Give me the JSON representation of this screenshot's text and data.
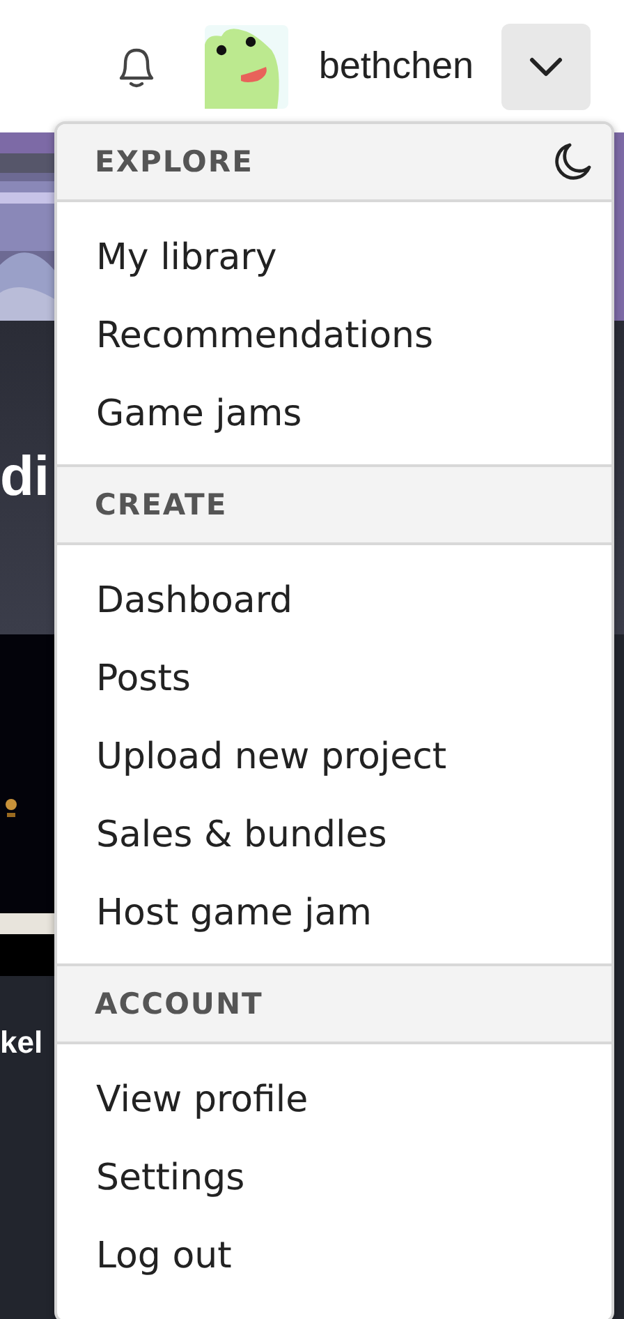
{
  "header": {
    "username": "bethchen"
  },
  "background": {
    "heading": "di",
    "subheading": "kel"
  },
  "menu": {
    "sections": [
      {
        "title": "EXPLORE",
        "night_toggle": true,
        "items": [
          "My library",
          "Recommendations",
          "Game jams"
        ]
      },
      {
        "title": "CREATE",
        "items": [
          "Dashboard",
          "Posts",
          "Upload new project",
          "Sales & bundles",
          "Host game jam"
        ]
      },
      {
        "title": "ACCOUNT",
        "items": [
          "View profile",
          "Settings",
          "Log out"
        ]
      }
    ]
  }
}
